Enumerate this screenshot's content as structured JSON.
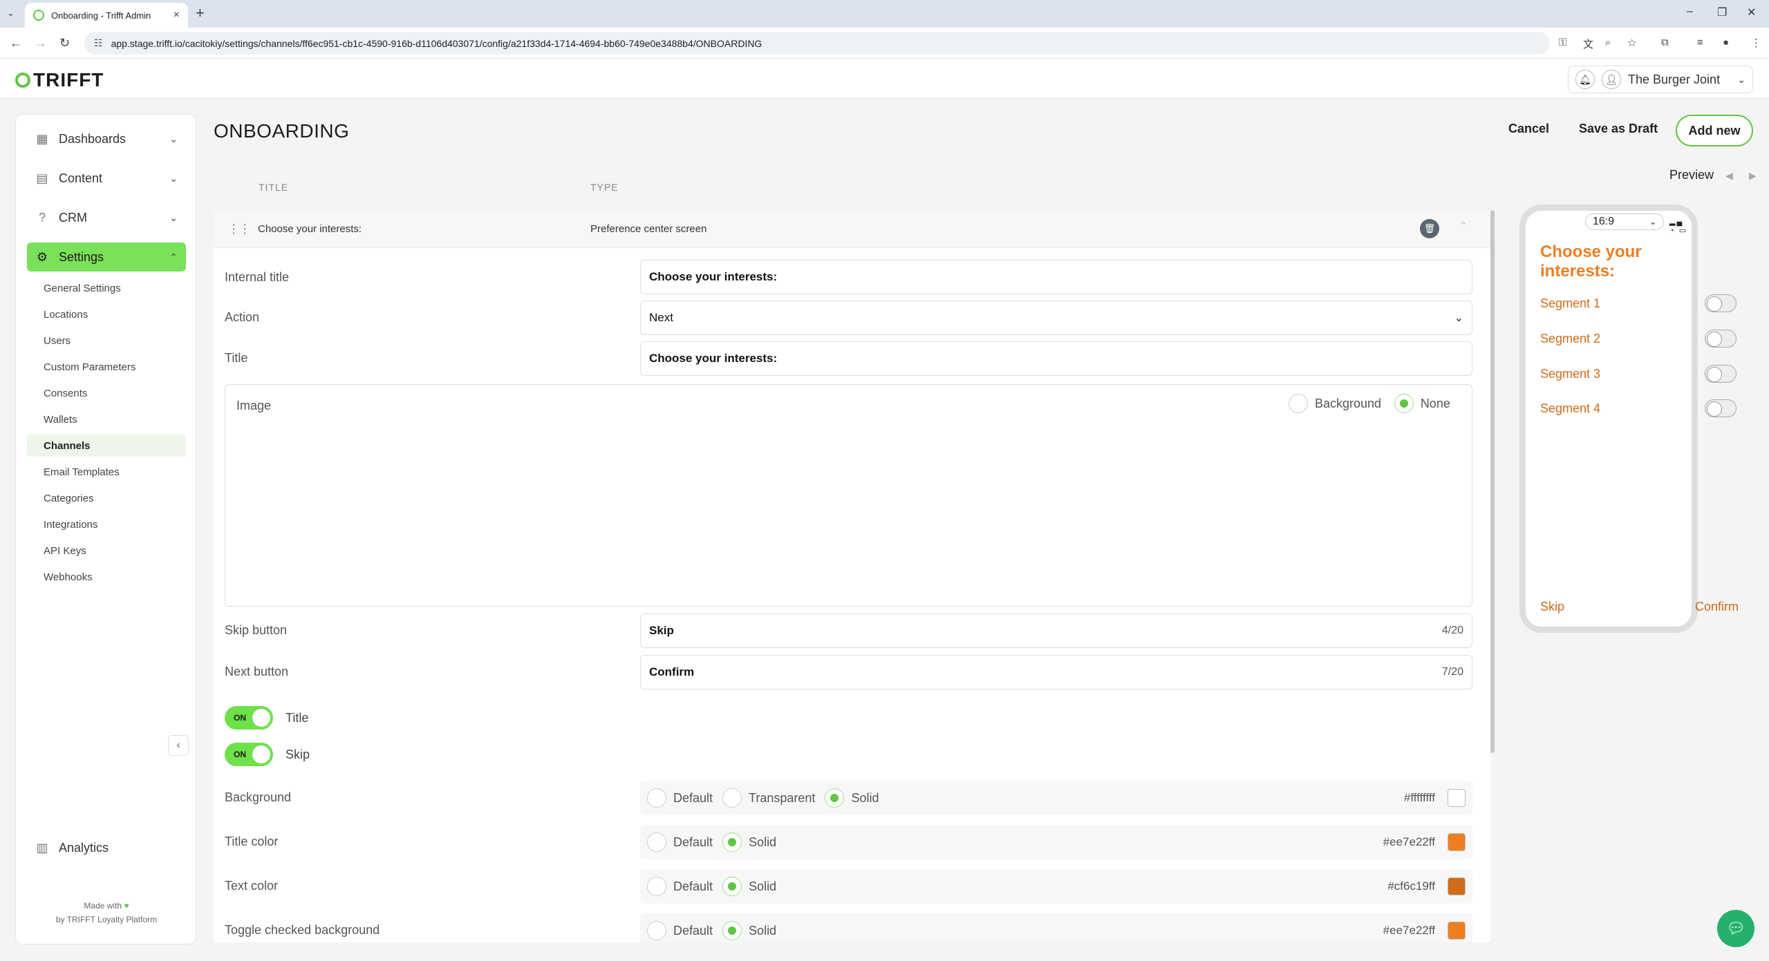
{
  "browser": {
    "tab_title": "Onboarding - Trifft Admin",
    "url": "app.stage.trifft.io/cacitokiy/settings/channels/ff6ec951-cb1c-4590-916b-d1106d403071/config/a21f33d4-1714-4694-bb60-749e0e3488b4/ONBOARDING"
  },
  "header": {
    "logo": "TRIFFT",
    "account_name": "The Burger Joint"
  },
  "sidebar": {
    "items": [
      {
        "label": "Dashboards"
      },
      {
        "label": "Content"
      },
      {
        "label": "CRM"
      },
      {
        "label": "Settings"
      }
    ],
    "settings_sub": [
      {
        "label": "General Settings"
      },
      {
        "label": "Locations"
      },
      {
        "label": "Users"
      },
      {
        "label": "Custom Parameters"
      },
      {
        "label": "Consents"
      },
      {
        "label": "Wallets"
      },
      {
        "label": "Channels"
      },
      {
        "label": "Email Templates"
      },
      {
        "label": "Categories"
      },
      {
        "label": "Integrations"
      },
      {
        "label": "API Keys"
      },
      {
        "label": "Webhooks"
      }
    ],
    "analytics": "Analytics",
    "made_with": "Made with",
    "made_by": "by TRIFFT Loyalty Platform"
  },
  "page": {
    "title": "ONBOARDING",
    "cancel": "Cancel",
    "save_draft": "Save as Draft",
    "add_new": "Add new",
    "col_title": "TITLE",
    "col_type": "TYPE",
    "preview_label": "Preview"
  },
  "screen": {
    "row_title": "Choose your interests:",
    "row_type": "Preference center screen",
    "internal_title_label": "Internal title",
    "internal_title_value": "Choose your interests:",
    "action_label": "Action",
    "action_value": "Next",
    "title_label": "Title",
    "title_value": "Choose your interests:",
    "image_label": "Image",
    "image_opt_background": "Background",
    "image_opt_none": "None",
    "image_selected": "None",
    "skip_label": "Skip button",
    "skip_value": "Skip",
    "skip_counter": "4/20",
    "next_label": "Next button",
    "next_value": "Confirm",
    "next_counter": "7/20",
    "toggle_on_text": "ON",
    "toggle_title_label": "Title",
    "toggle_skip_label": "Skip",
    "colors": [
      {
        "label": "Background",
        "options": [
          "Default",
          "Transparent",
          "Solid"
        ],
        "selected": "Solid",
        "hex": "#ffffffff",
        "swatch": "#ffffff"
      },
      {
        "label": "Title color",
        "options": [
          "Default",
          "Solid"
        ],
        "selected": "Solid",
        "hex": "#ee7e22ff",
        "swatch": "#ee7e22"
      },
      {
        "label": "Text color",
        "options": [
          "Default",
          "Solid"
        ],
        "selected": "Solid",
        "hex": "#cf6c19ff",
        "swatch": "#cf6c19"
      },
      {
        "label": "Toggle checked background",
        "options": [
          "Default",
          "Solid"
        ],
        "selected": "Solid",
        "hex": "#ee7e22ff",
        "swatch": "#ee7e22"
      }
    ]
  },
  "preview": {
    "ratio": "16:9",
    "title": "Choose your interests:",
    "segments": [
      "Segment 1",
      "Segment 2",
      "Segment 3",
      "Segment 4"
    ],
    "skip": "Skip",
    "confirm": "Confirm",
    "title_color": "#ee7e22",
    "text_color": "#cf6c19"
  },
  "colors": {
    "brand_green": "#62c446",
    "active_green": "#7be05a"
  }
}
